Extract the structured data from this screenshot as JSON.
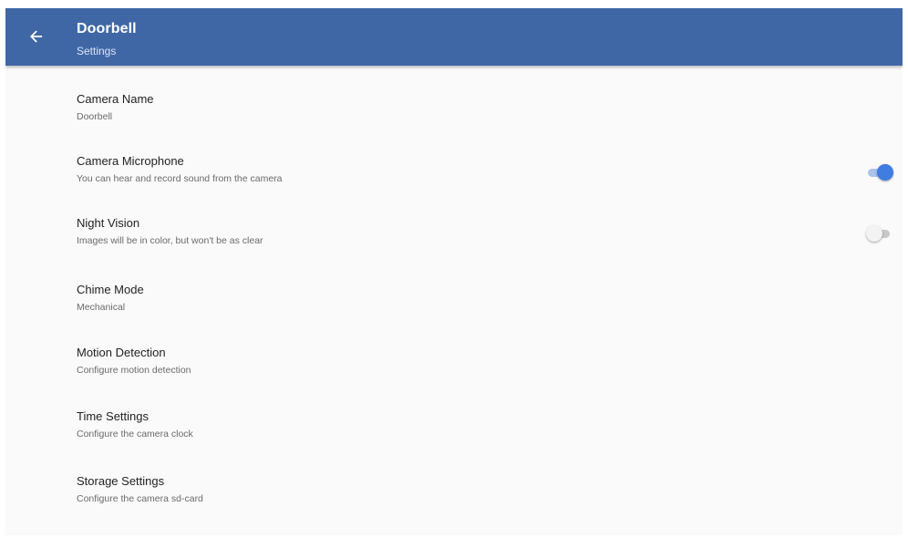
{
  "appbar": {
    "title": "Doorbell",
    "subtitle": "Settings",
    "back_icon": "arrow-back-icon",
    "color": "#3f67a6"
  },
  "settings": [
    {
      "title": "Camera Name",
      "summary": "Doorbell"
    },
    {
      "title": "Camera Microphone",
      "summary": "You can hear and record sound from the camera",
      "toggle": true
    },
    {
      "title": "Night Vision",
      "summary": "Images will be in color, but won't be as clear",
      "toggle": false
    },
    {
      "title": "Chime Mode",
      "summary": "Mechanical"
    },
    {
      "title": "Motion Detection",
      "summary": "Configure motion detection"
    },
    {
      "title": "Time Settings",
      "summary": "Configure the camera clock"
    },
    {
      "title": "Storage Settings",
      "summary": "Configure the camera sd-card"
    }
  ],
  "colors": {
    "accent": "#3f7de0",
    "background": "#fafafa"
  }
}
